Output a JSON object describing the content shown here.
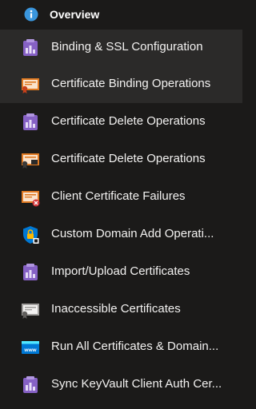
{
  "header": {
    "icon": "info-icon",
    "label": "Overview"
  },
  "items": [
    {
      "label": "Binding & SSL Configuration",
      "icon": "purple-workbook-icon",
      "selected": true
    },
    {
      "label": "Certificate Binding Operations",
      "icon": "certificate-orange-icon",
      "selected": true
    },
    {
      "label": "Certificate Delete Operations",
      "icon": "purple-workbook-icon",
      "selected": false
    },
    {
      "label": "Certificate Delete Operations",
      "icon": "certificate-dark-icon",
      "selected": false
    },
    {
      "label": "Client Certificate Failures",
      "icon": "certificate-error-icon",
      "selected": false
    },
    {
      "label": "Custom Domain Add Operati...",
      "icon": "shield-lock-icon",
      "selected": false
    },
    {
      "label": "Import/Upload Certificates",
      "icon": "purple-workbook-icon",
      "selected": false
    },
    {
      "label": "Inaccessible Certificates",
      "icon": "certificate-gray-icon",
      "selected": false
    },
    {
      "label": "Run All Certificates & Domain...",
      "icon": "www-icon",
      "selected": false
    },
    {
      "label": "Sync KeyVault Client Auth Cer...",
      "icon": "purple-workbook-icon",
      "selected": false
    }
  ],
  "colors": {
    "background": "#1b1a19",
    "selected": "#2b2a29",
    "text": "#f3f2f1",
    "purple": "#8661c5",
    "orange": "#e07a22",
    "blue": "#0078d4"
  }
}
